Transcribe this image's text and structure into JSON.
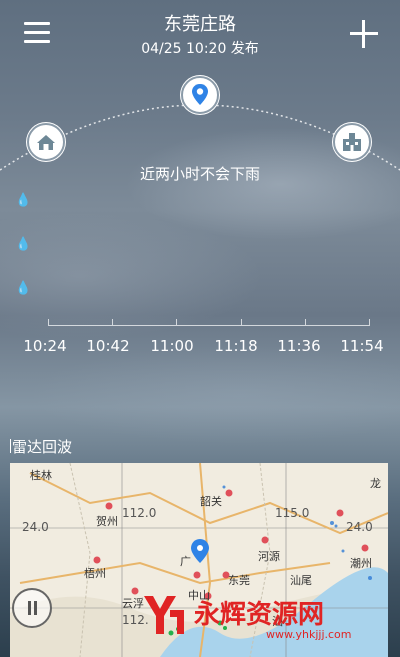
{
  "header": {
    "city": "东莞庄路",
    "publish_time": "04/25  10:20 发布"
  },
  "forecast": {
    "message": "近两小时不会下雨",
    "times": [
      "10:24",
      "10:42",
      "11:00",
      "11:18",
      "11:36",
      "11:54"
    ]
  },
  "radar": {
    "title": "雷达回波",
    "map_labels": [
      "桂林",
      "贺州",
      "112.0",
      "韶关",
      "115.0",
      "龙",
      "24.0",
      "24.0",
      "梧州",
      "广",
      "河源",
      "东莞",
      "汕尾",
      "潮州",
      "云浮",
      "中山",
      "112.",
      "汕"
    ]
  },
  "watermark": {
    "text": "永辉资源网",
    "url": "www.yhkjjj.com"
  }
}
